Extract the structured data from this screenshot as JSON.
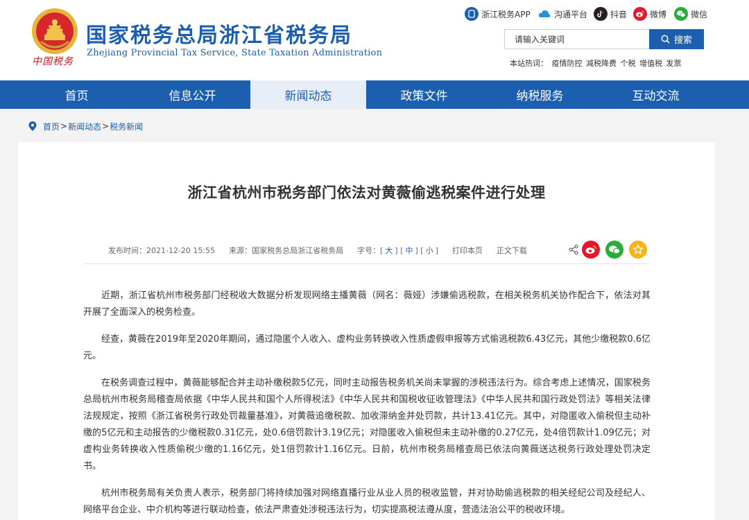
{
  "header": {
    "emblem_caption": "中国税务",
    "title": "国家税务总局浙江省税务局",
    "subtitle": "Zhejiang Provincial Tax Service, State Taxation Administration"
  },
  "social": [
    {
      "label": "浙江税务APP",
      "icon": "app-icon",
      "color": "#1b5fae"
    },
    {
      "label": "沟通平台",
      "icon": "cloud-icon",
      "color": "#2c8fd6"
    },
    {
      "label": "抖音",
      "icon": "douyin-icon",
      "color": "#222222"
    },
    {
      "label": "微博",
      "icon": "weibo-icon",
      "color": "#e6162d"
    },
    {
      "label": "微信",
      "icon": "wechat-icon",
      "color": "#2aae3b"
    }
  ],
  "search": {
    "placeholder": "请输入关键词",
    "button_label": "搜索"
  },
  "hot": {
    "label": "本站热词：",
    "terms": [
      "疫情防控",
      "减税降费",
      "个税",
      "增值税",
      "发票"
    ]
  },
  "nav": [
    {
      "label": "首页",
      "active": false
    },
    {
      "label": "信息公开",
      "active": false
    },
    {
      "label": "新闻动态",
      "active": true
    },
    {
      "label": "政策文件",
      "active": false
    },
    {
      "label": "纳税服务",
      "active": false
    },
    {
      "label": "互动交流",
      "active": false
    }
  ],
  "breadcrumb": [
    "首页",
    "新闻动态",
    "税务新闻"
  ],
  "article": {
    "title": "浙江省杭州市税务部门依法对黄薇偷逃税案件进行处理",
    "publish_time": "发布时间：2021-12-20  15:55",
    "source": "来源：国家税务总局浙江省税务局",
    "font_label": "字号：",
    "font_sizes": [
      "大",
      "中",
      "小"
    ],
    "print": "打印本页",
    "download": "正文下载",
    "paragraphs": [
      "近期，浙江省杭州市税务部门经税收大数据分析发现网络主播黄薇（网名：薇娅）涉嫌偷逃税款，在相关税务机关协作配合下，依法对其开展了全面深入的税务检查。",
      "经查，黄薇在2019年至2020年期间，通过隐匿个人收入、虚构业务转换收入性质虚假申报等方式偷逃税款6.43亿元，其他少缴税款0.6亿元。",
      "在税务调查过程中，黄薇能够配合并主动补缴税款5亿元，同时主动报告税务机关尚未掌握的涉税违法行为。综合考虑上述情况，国家税务总局杭州市税务局稽查局依据《中华人民共和国个人所得税法》《中华人民共和国税收征收管理法》《中华人民共和国行政处罚法》等相关法律法规规定，按照《浙江省税务行政处罚裁量基准》，对黄薇追缴税款、加收滞纳金并处罚款，共计13.41亿元。其中，对隐匿收入偷税但主动补缴的5亿元和主动报告的少缴税款0.31亿元，处0.6倍罚款计3.19亿元；对隐匿收入偷税但未主动补缴的0.27亿元，处4倍罚款计1.09亿元；对虚构业务转换收入性质偷税少缴的1.16亿元，处1倍罚款计1.16亿元。日前，杭州市税务局稽查局已依法向黄薇送达税务行政处理处罚决定书。",
      "杭州市税务局有关负责人表示，税务部门将持续加强对网络直播行业从业人员的税收监管，并对协助偷逃税款的相关经纪公司及经纪人、网络平台企业、中介机构等进行联动检查，依法严肃查处涉税违法行为，切实提高税法遵从度，营造法治公平的税收环境。"
    ]
  },
  "share": [
    {
      "icon": "share-icon",
      "color": "#666666"
    },
    {
      "icon": "weibo-share-icon",
      "color": "#e6162d"
    },
    {
      "icon": "wechat-share-icon",
      "color": "#2aae3b"
    },
    {
      "icon": "favorite-star-icon",
      "color": "#f3b51a"
    }
  ],
  "colors": {
    "brand_blue": "#1b5fae",
    "nav_active_bg": "#e7eef8",
    "emblem_red": "#c9161c"
  }
}
